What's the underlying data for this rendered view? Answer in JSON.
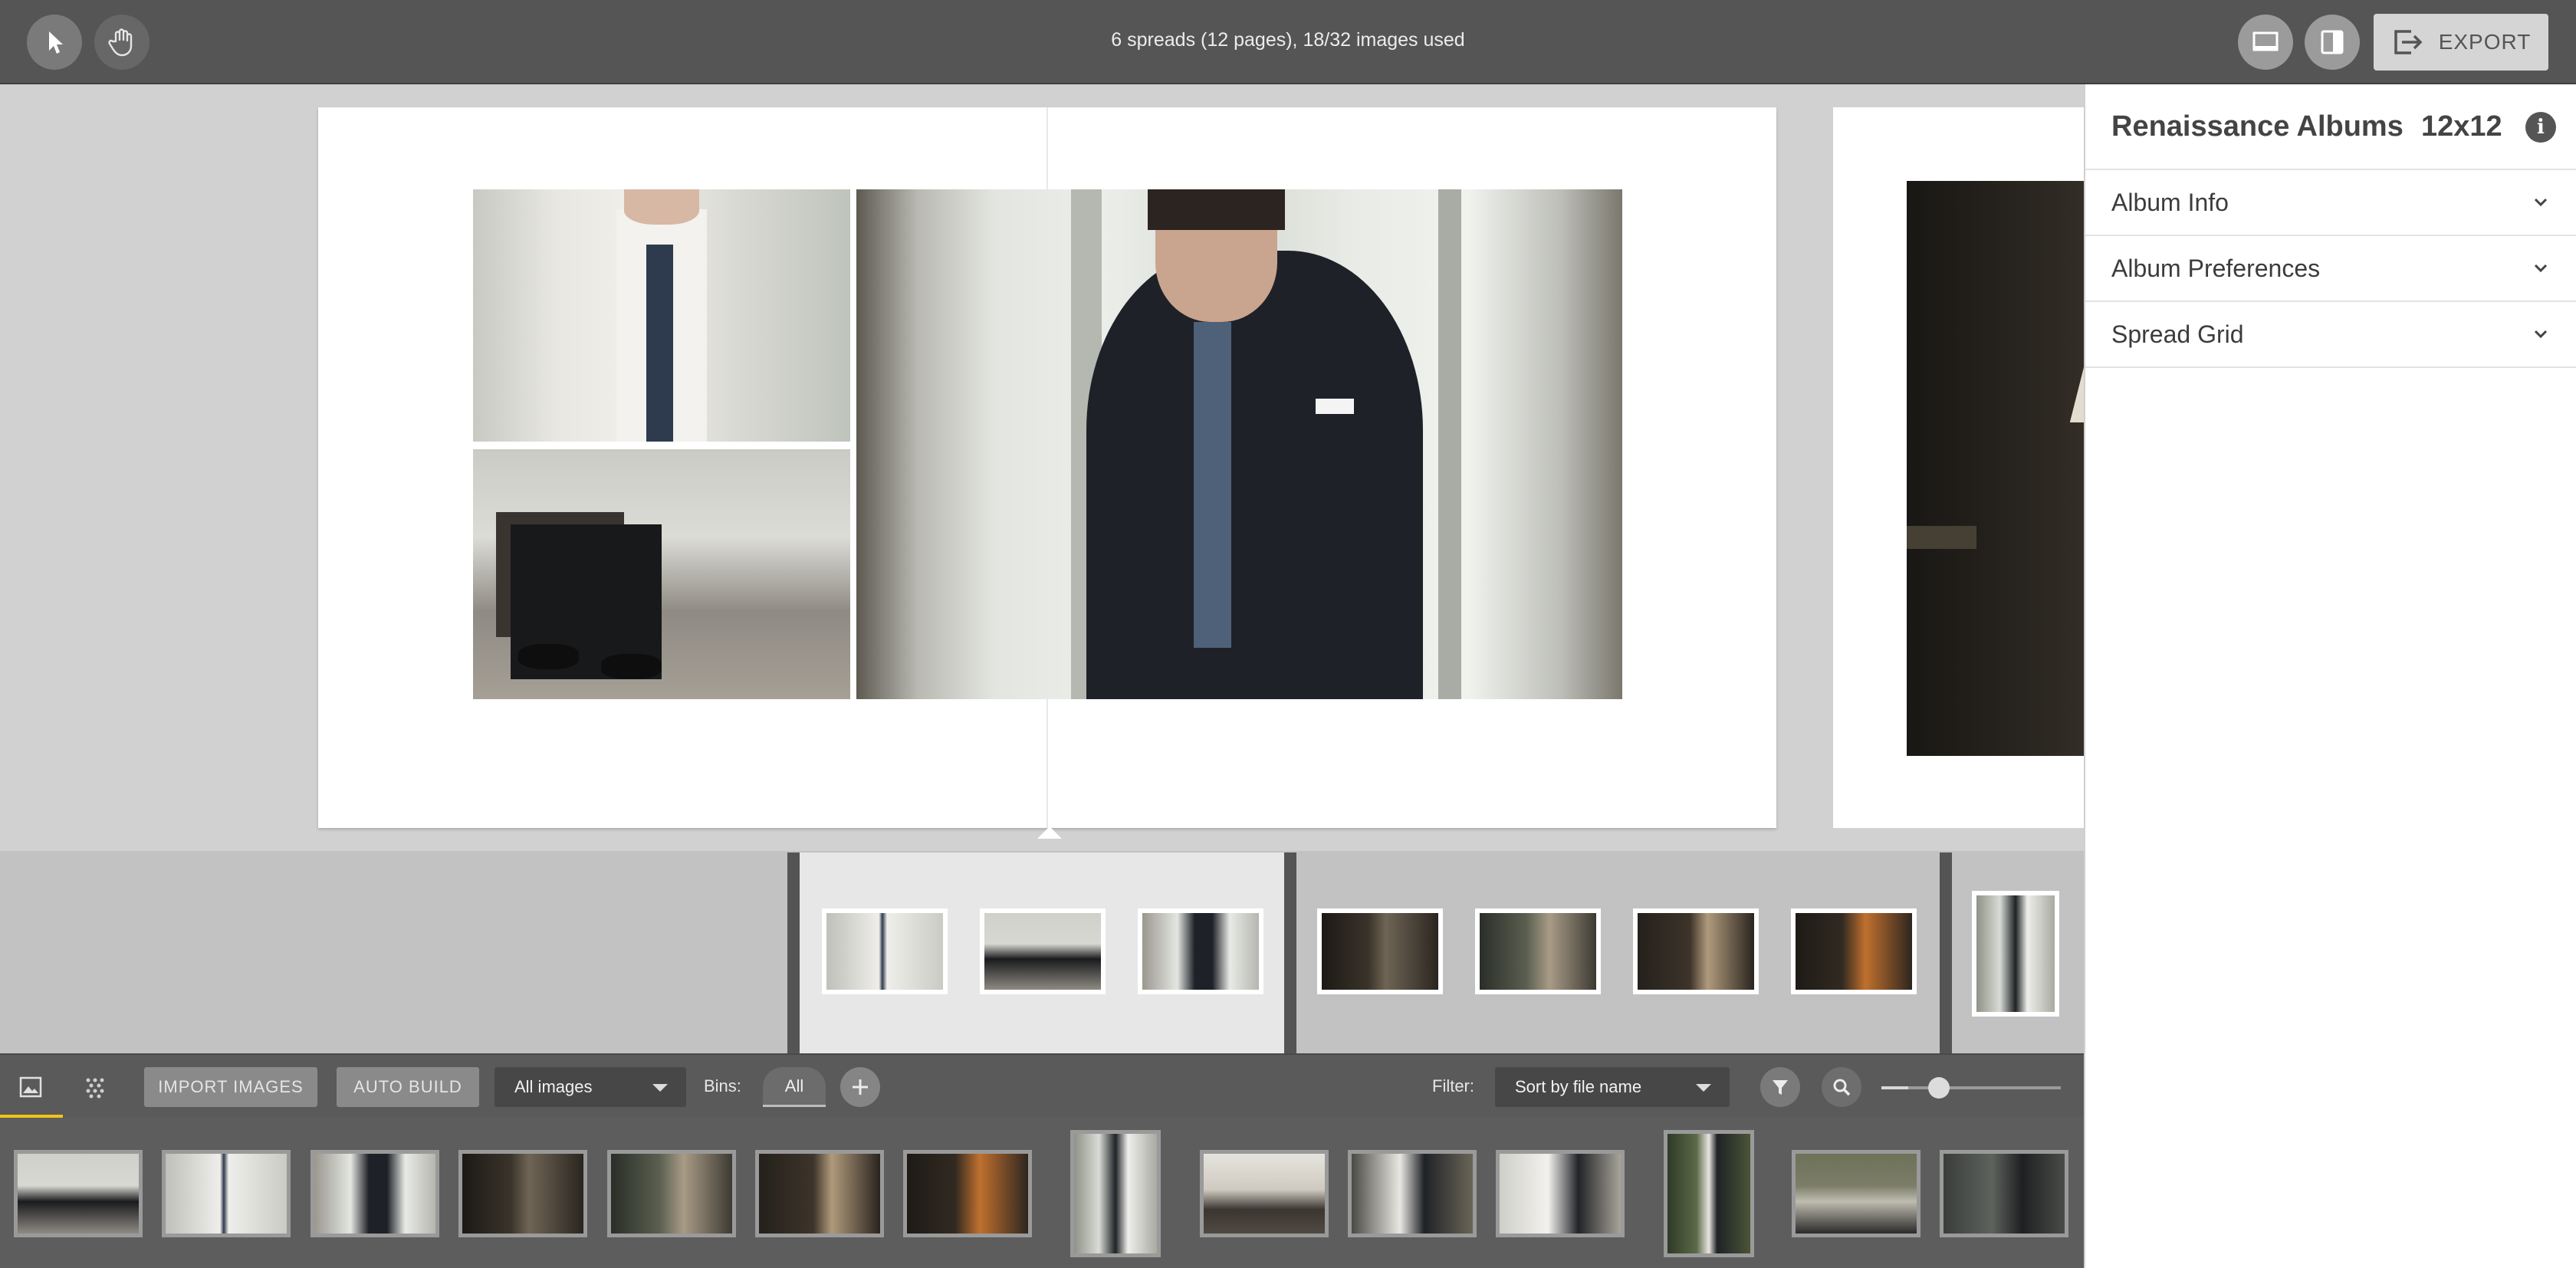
{
  "toolbar": {
    "status": "6 spreads (12 pages), 18/32 images used",
    "export_label": "EXPORT",
    "icons": [
      "pointer-icon",
      "hand-icon",
      "single-page-view-icon",
      "panel-toggle-icon",
      "export-icon"
    ]
  },
  "panel": {
    "title": "Renaissance Albums",
    "size": "12x12",
    "info_symbol": "i",
    "sections": [
      {
        "label": "Album Info"
      },
      {
        "label": "Album Preferences"
      },
      {
        "label": "Spread Grid"
      }
    ]
  },
  "bin_toolbar": {
    "import_label": "IMPORT IMAGES",
    "auto_build_label": "AUTO BUILD",
    "images_select": "All images",
    "bins_label": "Bins:",
    "bins_all": "All",
    "filter_label": "Filter:",
    "sort_select": "Sort by file name",
    "zoom_level": 0.15
  },
  "colors": {
    "accent": "#f2c417",
    "topbar": "#555555",
    "panel_text": "#444444"
  }
}
